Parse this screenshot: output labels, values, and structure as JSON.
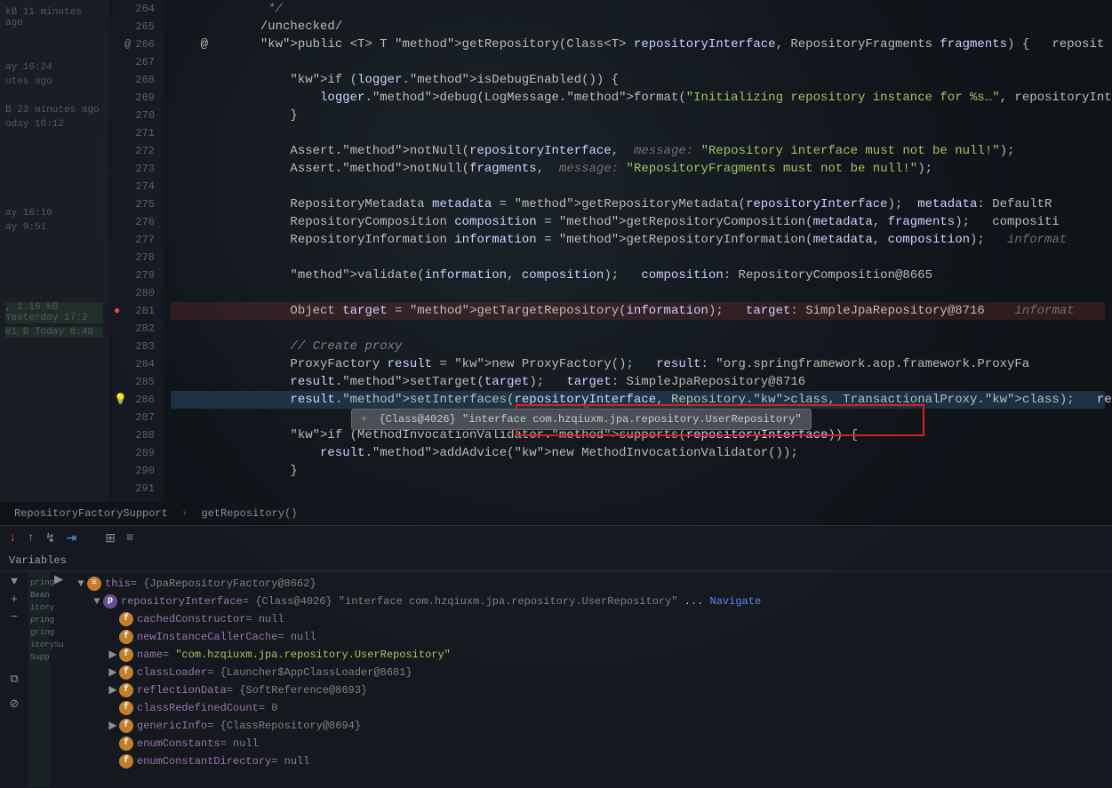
{
  "left_panel": {
    "items": [
      "kB  11 minutes ago",
      "ay 16:24",
      "utes ago",
      "B  23 minutes ago",
      "oday 10:12",
      "ay 16:10",
      "ay 9:51",
      ", 1.16 kB Yesterday 17:2",
      "01 B Today 8:48"
    ]
  },
  "gutter": {
    "start": 264,
    "end": 291
  },
  "code": {
    "lines": {
      "264": {
        "text": "             */",
        "cls": "com"
      },
      "265": {
        "text": "            /unchecked/",
        "cls": ""
      },
      "266": {
        "text": "    @       public <T> T getRepository(Class<T> repositoryInterface, RepositoryFragments fragments) {   reposit",
        "cls": ""
      },
      "267": {
        "text": "",
        "cls": ""
      },
      "268": {
        "text": "                if (logger.isDebugEnabled()) {",
        "cls": ""
      },
      "269": {
        "text": "                    logger.debug(LogMessage.format(\"Initializing repository instance for %s…\", repositoryInte",
        "cls": ""
      },
      "270": {
        "text": "                }",
        "cls": ""
      },
      "271": {
        "text": "",
        "cls": ""
      },
      "272": {
        "text": "                Assert.notNull(repositoryInterface,  message: \"Repository interface must not be null!\");",
        "cls": ""
      },
      "273": {
        "text": "                Assert.notNull(fragments,  message: \"RepositoryFragments must not be null!\");",
        "cls": ""
      },
      "274": {
        "text": "",
        "cls": ""
      },
      "275": {
        "text": "                RepositoryMetadata metadata = getRepositoryMetadata(repositoryInterface);  metadata: DefaultR",
        "cls": ""
      },
      "276": {
        "text": "                RepositoryComposition composition = getRepositoryComposition(metadata, fragments);   compositi",
        "cls": ""
      },
      "277": {
        "text": "                RepositoryInformation information = getRepositoryInformation(metadata, composition);   informat",
        "cls": ""
      },
      "278": {
        "text": "",
        "cls": ""
      },
      "279": {
        "text": "                validate(information, composition);   composition: RepositoryComposition@8665",
        "cls": ""
      },
      "280": {
        "text": "",
        "cls": ""
      },
      "281": {
        "text": "                Object target = getTargetRepository(information);   target: SimpleJpaRepository@8716    informat",
        "cls": ""
      },
      "282": {
        "text": "",
        "cls": ""
      },
      "283": {
        "text": "                // Create proxy",
        "cls": ""
      },
      "284": {
        "text": "                ProxyFactory result = new ProxyFactory();   result: \"org.springframework.aop.framework.ProxyFa",
        "cls": ""
      },
      "285": {
        "text": "                result.setTarget(target);   target: SimpleJpaRepository@8716",
        "cls": ""
      },
      "286": {
        "text": "                result.setInterfaces(repositoryInterface, Repository.class, TransactionalProxy.class);   result",
        "cls": ""
      },
      "287": {
        "text": "",
        "cls": ""
      },
      "288": {
        "text": "                if (MethodInvocationValidator.supports(repositoryInterface)) {",
        "cls": ""
      },
      "289": {
        "text": "                    result.addAdvice(new MethodInvocationValidator());",
        "cls": ""
      },
      "290": {
        "text": "                }",
        "cls": ""
      },
      "291": {
        "text": "",
        "cls": ""
      }
    }
  },
  "tooltip": {
    "text": "{Class@4026} \"interface com.hzqiuxm.jpa.repository.UserRepository\"",
    "plus": "+"
  },
  "breadcrumb": {
    "item1": "RepositoryFactorySupport",
    "item2": "getRepository()"
  },
  "debug": {
    "vars_label": "Variables",
    "tree": [
      {
        "indent": 0,
        "arrow": "▼",
        "icon": "",
        "name": "this",
        "sep": " = ",
        "val": "{JpaRepositoryFactory@8662}",
        "ntype": "v"
      },
      {
        "indent": 1,
        "arrow": "▼",
        "icon": "p",
        "name": "repositoryInterface",
        "sep": " = ",
        "val": "{Class@4026} \"interface com.hzqiuxm.jpa.repository.UserRepository\" ... Navigate",
        "link": true
      },
      {
        "indent": 2,
        "arrow": "",
        "icon": "f",
        "name": "cachedConstructor",
        "sep": " = ",
        "val": "null"
      },
      {
        "indent": 2,
        "arrow": "",
        "icon": "f",
        "name": "newInstanceCallerCache",
        "sep": " = ",
        "val": "null"
      },
      {
        "indent": 2,
        "arrow": "▶",
        "icon": "f",
        "name": "name",
        "sep": " = ",
        "val": "\"com.hzqiuxm.jpa.repository.UserRepository\"",
        "str": true
      },
      {
        "indent": 2,
        "arrow": "▶",
        "icon": "f",
        "name": "classLoader",
        "sep": " = ",
        "val": "{Launcher$AppClassLoader@8681}"
      },
      {
        "indent": 2,
        "arrow": "▶",
        "icon": "f",
        "name": "reflectionData",
        "sep": " = ",
        "val": "{SoftReference@8693}"
      },
      {
        "indent": 2,
        "arrow": "",
        "icon": "f",
        "name": "classRedefinedCount",
        "sep": " = ",
        "val": "0"
      },
      {
        "indent": 2,
        "arrow": "▶",
        "icon": "f",
        "name": "genericInfo",
        "sep": " = ",
        "val": "{ClassRepository@8694}"
      },
      {
        "indent": 2,
        "arrow": "",
        "icon": "f",
        "name": "enumConstants",
        "sep": " = ",
        "val": "null"
      },
      {
        "indent": 2,
        "arrow": "",
        "icon": "f",
        "name": "enumConstantDirectory",
        "sep": " = ",
        "val": "null"
      }
    ]
  },
  "right_gutter": [
    "pring",
    "Bean",
    "itory",
    "pring",
    "gring",
    "itorySu",
    "Supp"
  ]
}
